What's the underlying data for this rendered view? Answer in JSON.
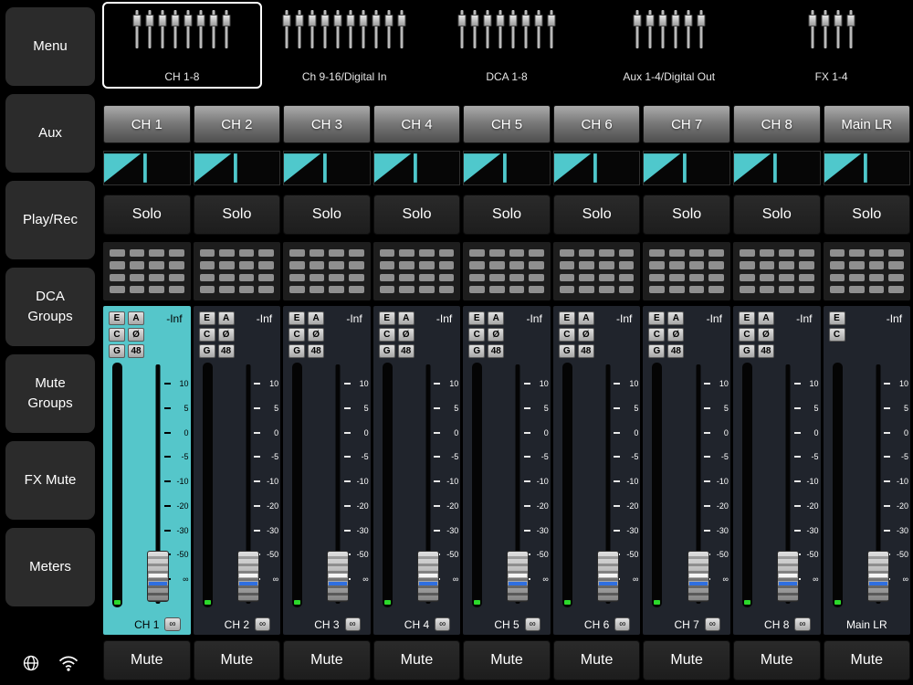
{
  "colors": {
    "accent": "#4fc8cc",
    "selected_channel_bg": "#55c6ca",
    "meter_green": "#2bd82b",
    "fader_blue": "#2f6fe0"
  },
  "sidebar": {
    "items": [
      {
        "label": "Menu"
      },
      {
        "label": "Aux"
      },
      {
        "label": "Play/Rec"
      },
      {
        "label": "DCA\nGroups"
      },
      {
        "label": "Mute\nGroups"
      },
      {
        "label": "FX Mute"
      },
      {
        "label": "Meters"
      }
    ],
    "icons": [
      {
        "name": "globe-icon"
      },
      {
        "name": "wifi-icon"
      }
    ]
  },
  "tabs": [
    {
      "label": "CH 1-8",
      "fader_icons": 8,
      "selected": true
    },
    {
      "label": "Ch 9-16/Digital In",
      "fader_icons": 10,
      "selected": false
    },
    {
      "label": "DCA 1-8",
      "fader_icons": 8,
      "selected": false
    },
    {
      "label": "Aux 1-4/Digital Out",
      "fader_icons": 6,
      "selected": false
    },
    {
      "label": "FX 1-4",
      "fader_icons": 4,
      "selected": false
    }
  ],
  "strings": {
    "solo": "Solo",
    "mute": "Mute"
  },
  "fader_scale": [
    "10",
    "5",
    "0",
    "-5",
    "-10",
    "-20",
    "-30",
    "-50",
    "∞"
  ],
  "channels": [
    {
      "name": "CH 1",
      "selected": true,
      "level": "-Inf",
      "value_badge": "∞",
      "chips": [
        [
          "E",
          "A"
        ],
        [
          "C",
          "Ø"
        ],
        [
          "G",
          "48"
        ]
      ]
    },
    {
      "name": "CH 2",
      "selected": false,
      "level": "-Inf",
      "value_badge": "∞",
      "chips": [
        [
          "E",
          "A"
        ],
        [
          "C",
          "Ø"
        ],
        [
          "G",
          "48"
        ]
      ]
    },
    {
      "name": "CH 3",
      "selected": false,
      "level": "-Inf",
      "value_badge": "∞",
      "chips": [
        [
          "E",
          "A"
        ],
        [
          "C",
          "Ø"
        ],
        [
          "G",
          "48"
        ]
      ]
    },
    {
      "name": "CH 4",
      "selected": false,
      "level": "-Inf",
      "value_badge": "∞",
      "chips": [
        [
          "E",
          "A"
        ],
        [
          "C",
          "Ø"
        ],
        [
          "G",
          "48"
        ]
      ]
    },
    {
      "name": "CH 5",
      "selected": false,
      "level": "-Inf",
      "value_badge": "∞",
      "chips": [
        [
          "E",
          "A"
        ],
        [
          "C",
          "Ø"
        ],
        [
          "G",
          "48"
        ]
      ]
    },
    {
      "name": "CH 6",
      "selected": false,
      "level": "-Inf",
      "value_badge": "∞",
      "chips": [
        [
          "E",
          "A"
        ],
        [
          "C",
          "Ø"
        ],
        [
          "G",
          "48"
        ]
      ]
    },
    {
      "name": "CH 7",
      "selected": false,
      "level": "-Inf",
      "value_badge": "∞",
      "chips": [
        [
          "E",
          "A"
        ],
        [
          "C",
          "Ø"
        ],
        [
          "G",
          "48"
        ]
      ]
    },
    {
      "name": "CH 8",
      "selected": false,
      "level": "-Inf",
      "value_badge": "∞",
      "chips": [
        [
          "E",
          "A"
        ],
        [
          "C",
          "Ø"
        ],
        [
          "G",
          "48"
        ]
      ]
    },
    {
      "name": "Main LR",
      "selected": false,
      "level": "-Inf",
      "value_badge": null,
      "chips": [
        [
          "E"
        ],
        [
          "C"
        ]
      ]
    }
  ]
}
